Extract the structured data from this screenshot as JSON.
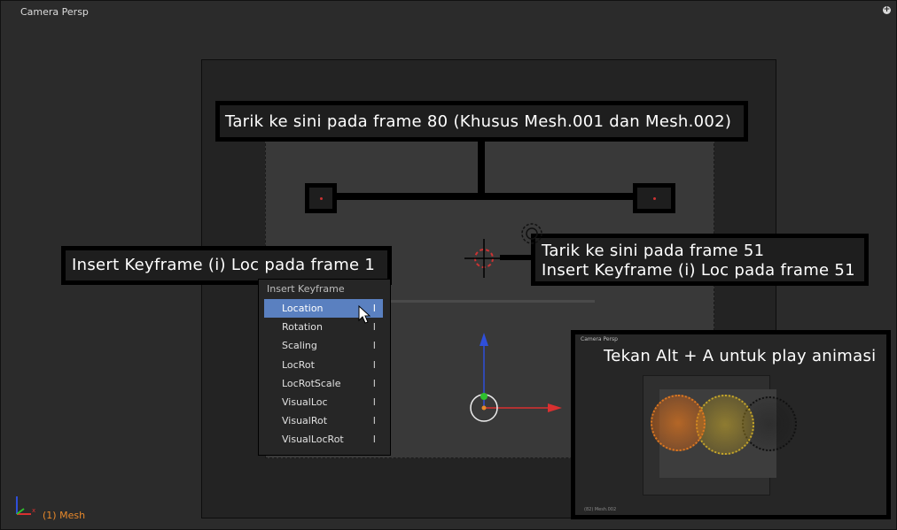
{
  "viewport": {
    "title": "Camera Persp",
    "status_label": "(1) Mesh"
  },
  "callouts": {
    "top": "Tarik ke sini pada frame 80 (Khusus Mesh.001 dan Mesh.002)",
    "left": "Insert Keyframe (i) Loc pada frame 1",
    "right_line1": "Tarik ke sini pada frame 51",
    "right_line2": "Insert Keyframe (i) Loc pada frame 51"
  },
  "menu": {
    "title": "Insert Keyframe",
    "items": [
      {
        "label": "Location",
        "shortcut": "I"
      },
      {
        "label": "Rotation",
        "shortcut": "I"
      },
      {
        "label": "Scaling",
        "shortcut": "I"
      },
      {
        "label": "LocRot",
        "shortcut": "I"
      },
      {
        "label": "LocRotScale",
        "shortcut": "I"
      },
      {
        "label": "VisualLoc",
        "shortcut": "I"
      },
      {
        "label": "VisualRot",
        "shortcut": "I"
      },
      {
        "label": "VisualLocRot",
        "shortcut": "I"
      }
    ],
    "active_index": 0
  },
  "inset": {
    "title": "Camera Persp",
    "caption": "Tekan Alt + A untuk play animasi",
    "footer": "(82) Mesh.002"
  },
  "icons": {
    "corner": "plus-circle-icon",
    "axis": "axis-gizmo-icon",
    "cursor": "mouse-pointer-icon"
  },
  "colors": {
    "background": "#2b2b2b",
    "menu_highlight": "#5a80c0",
    "status": "#e8892b",
    "axis_x": "#d93030",
    "axis_z": "#2f4fd9",
    "axis_y": "#2ec02e"
  }
}
